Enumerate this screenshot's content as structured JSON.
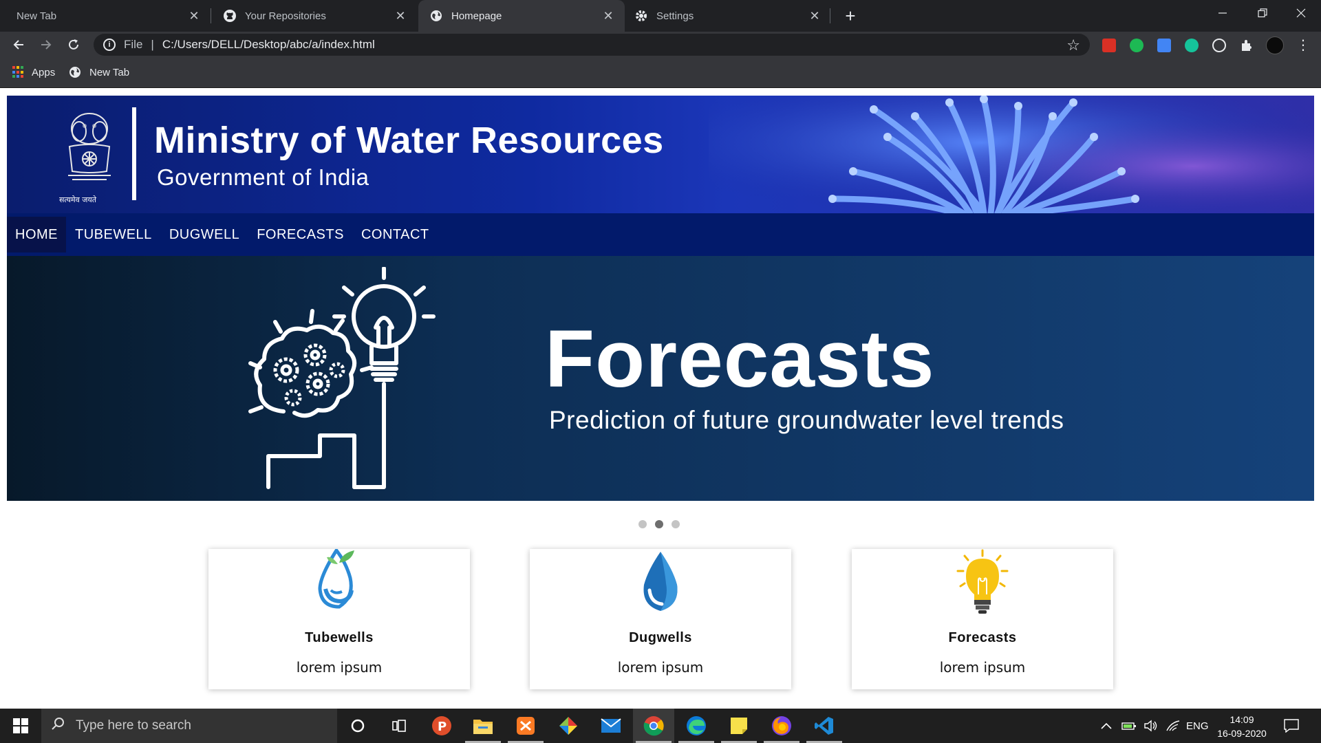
{
  "browser": {
    "tabs": [
      {
        "title": "New Tab",
        "icon": "none",
        "active": false
      },
      {
        "title": "Your Repositories",
        "icon": "github-icon",
        "active": false
      },
      {
        "title": "Homepage",
        "icon": "globe-icon",
        "active": true
      },
      {
        "title": "Settings",
        "icon": "gear-icon",
        "active": false
      }
    ],
    "address": {
      "scheme": "File",
      "url": "C:/Users/DELL/Desktop/abc/a/index.html"
    },
    "bookmarks": [
      {
        "label": "Apps",
        "icon": "apps-grid-icon"
      },
      {
        "label": "New Tab",
        "icon": "globe-icon"
      }
    ]
  },
  "site": {
    "header": {
      "title": "Ministry of Water Resources",
      "subtitle": "Government of India",
      "emblem_caption": "सत्यमेव जयते"
    },
    "nav": [
      "HOME",
      "TUBEWELL",
      "DUGWELL",
      "FORECASTS",
      "CONTACT"
    ],
    "hero": {
      "title": "Forecasts",
      "subtitle": "Prediction of future groundwater level trends",
      "slide_count": 3,
      "active_slide": 2
    },
    "cards": [
      {
        "title": "Tubewells",
        "desc": "lorem ipsum",
        "icon": "water-drop-leaf-icon"
      },
      {
        "title": "Dugwells",
        "desc": "lorem ipsum",
        "icon": "water-drop-icon"
      },
      {
        "title": "Forecasts",
        "desc": "lorem ipsum",
        "icon": "lightbulb-icon"
      }
    ]
  },
  "taskbar": {
    "search_placeholder": "Type here to search",
    "language": "ENG",
    "time": "14:09",
    "date": "16-09-2020"
  },
  "colors": {
    "nav_bg": "#021a6b",
    "banner_bg": "#0f2aa0",
    "hero_bg": "#0d2e54",
    "card_title": "#111111"
  }
}
